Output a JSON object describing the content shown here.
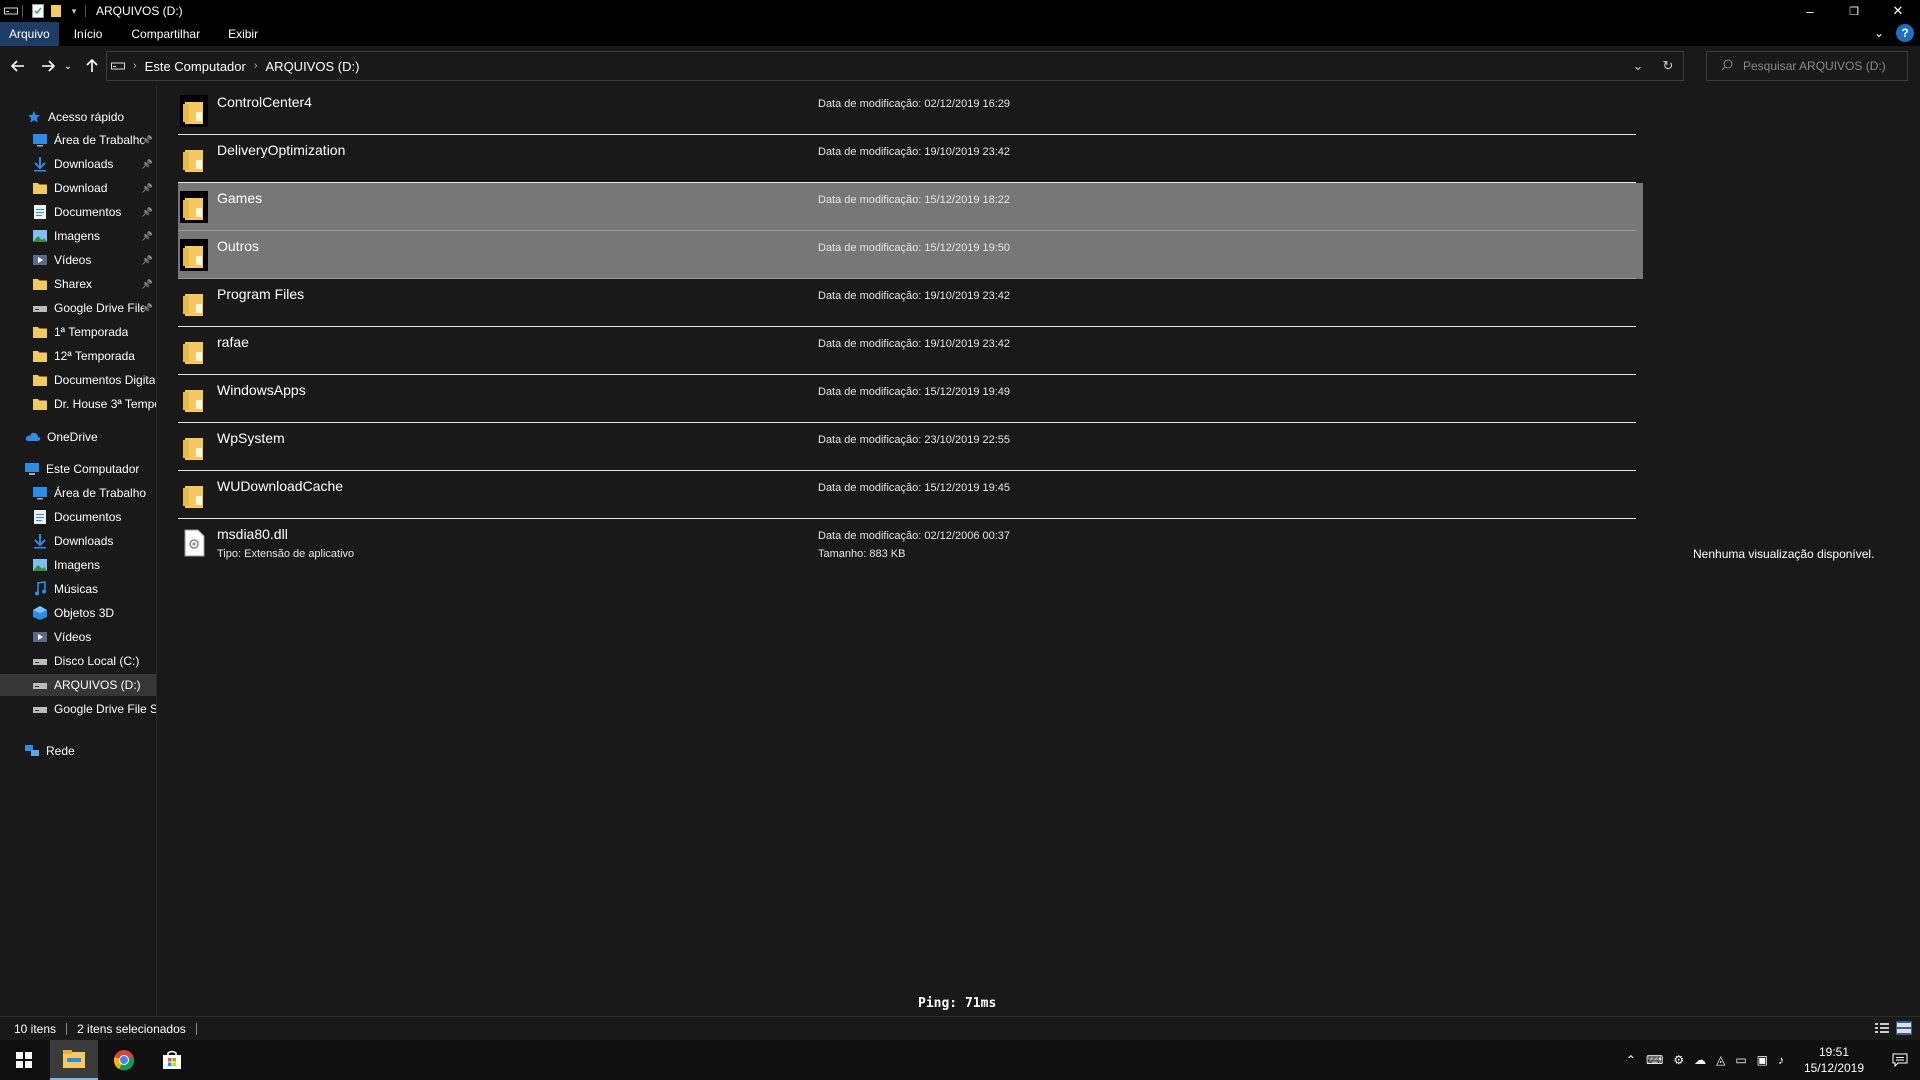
{
  "window": {
    "title": "ARQUIVOS (D:)",
    "minimize": "–",
    "restore": "❐",
    "close": "✕"
  },
  "ribbon": {
    "tabs": [
      "Arquivo",
      "Início",
      "Compartilhar",
      "Exibir"
    ],
    "help": "?"
  },
  "address": {
    "breadcrumb": [
      "Este Computador",
      "ARQUIVOS (D:)"
    ],
    "search_placeholder": "Pesquisar ARQUIVOS (D:)"
  },
  "sidebar": {
    "quick_access": "Acesso rápido",
    "quick_items": [
      {
        "label": "Área de Trabalho",
        "icon": "desktop-icon",
        "pinned": true
      },
      {
        "label": "Downloads",
        "icon": "download-icon",
        "pinned": true
      },
      {
        "label": "Download",
        "icon": "folder-icon",
        "pinned": true
      },
      {
        "label": "Documentos",
        "icon": "documents-icon",
        "pinned": true
      },
      {
        "label": "Imagens",
        "icon": "pictures-icon",
        "pinned": true
      },
      {
        "label": "Vídeos",
        "icon": "videos-icon",
        "pinned": true
      },
      {
        "label": "Sharex",
        "icon": "folder-icon",
        "pinned": true
      },
      {
        "label": "Google Drive File",
        "icon": "drive-icon",
        "pinned": true
      },
      {
        "label": "1ª Temporada",
        "icon": "folder-icon",
        "pinned": false
      },
      {
        "label": "12ª Temporada",
        "icon": "folder-icon",
        "pinned": false
      },
      {
        "label": "Documentos Digita",
        "icon": "folder-icon",
        "pinned": false
      },
      {
        "label": "Dr. House 3ª Tempo",
        "icon": "folder-icon",
        "pinned": false
      }
    ],
    "onedrive": "OneDrive",
    "this_pc": "Este Computador",
    "pc_items": [
      {
        "label": "Área de Trabalho",
        "icon": "desktop-icon"
      },
      {
        "label": "Documentos",
        "icon": "documents-icon"
      },
      {
        "label": "Downloads",
        "icon": "download-icon"
      },
      {
        "label": "Imagens",
        "icon": "pictures-icon"
      },
      {
        "label": "Músicas",
        "icon": "music-icon"
      },
      {
        "label": "Objetos 3D",
        "icon": "objects3d-icon"
      },
      {
        "label": "Vídeos",
        "icon": "videos-icon"
      },
      {
        "label": "Disco Local (C:)",
        "icon": "drive-icon"
      },
      {
        "label": "ARQUIVOS (D:)",
        "icon": "drive-icon",
        "selected": true
      },
      {
        "label": "Google Drive File St",
        "icon": "drive-icon"
      }
    ],
    "network": "Rede"
  },
  "files": [
    {
      "name": "ControlCenter4",
      "date": "Data de modificação: 02/12/2019 16:29",
      "selected": false,
      "type": "folder"
    },
    {
      "name": "DeliveryOptimization",
      "date": "Data de modificação: 19/10/2019 23:42",
      "selected": false,
      "type": "folder"
    },
    {
      "name": "Games",
      "date": "Data de modificação: 15/12/2019 18:22",
      "selected": true,
      "type": "folder"
    },
    {
      "name": "Outros",
      "date": "Data de modificação: 15/12/2019 19:50",
      "selected": true,
      "type": "folder"
    },
    {
      "name": "Program Files",
      "date": "Data de modificação: 19/10/2019 23:42",
      "selected": false,
      "type": "folder"
    },
    {
      "name": "rafae",
      "date": "Data de modificação: 19/10/2019 23:42",
      "selected": false,
      "type": "folder"
    },
    {
      "name": "WindowsApps",
      "date": "Data de modificação: 15/12/2019 19:49",
      "selected": false,
      "type": "folder"
    },
    {
      "name": "WpSystem",
      "date": "Data de modificação: 23/10/2019 22:55",
      "selected": false,
      "type": "folder"
    },
    {
      "name": "WUDownloadCache",
      "date": "Data de modificação: 15/12/2019 19:45",
      "selected": false,
      "type": "folder"
    },
    {
      "name": "msdia80.dll",
      "date": "Data de modificação: 02/12/2006 00:37",
      "subtype": "Tipo: Extensão de aplicativo",
      "size": "Tamanho: 883 KB",
      "selected": false,
      "type": "file"
    }
  ],
  "overlay": {
    "ping": "Ping: 71ms"
  },
  "preview": {
    "message": "Nenhuma visualização disponível."
  },
  "status": {
    "count": "10 itens",
    "selected": "2 itens selecionados"
  },
  "taskbar": {
    "time": "19:51",
    "date": "15/12/2019"
  },
  "colors": {
    "selection": "#777777",
    "folder": "#f4c95d",
    "accent": "#76b9ed"
  }
}
